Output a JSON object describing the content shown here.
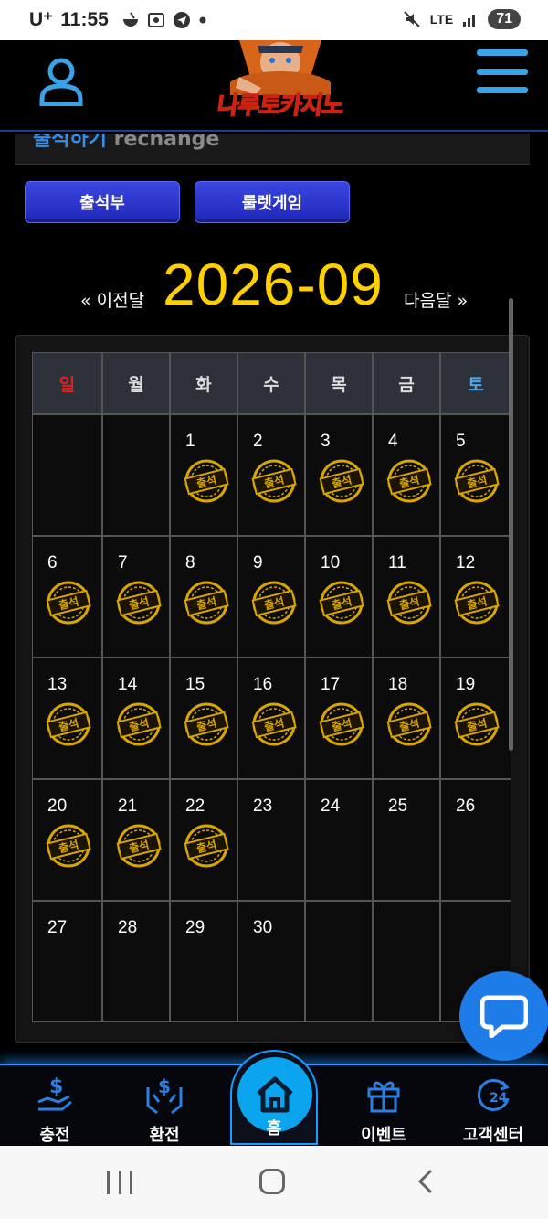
{
  "status_bar": {
    "carrier": "U⁺",
    "time": "11:55",
    "network": "LTE",
    "battery": "71"
  },
  "header": {
    "logo_text": "나루토카지노"
  },
  "subheader": {
    "title_ko": "출석하기",
    "title_en": "rechange"
  },
  "tabs": [
    {
      "label": "출석부"
    },
    {
      "label": "룰렛게임"
    }
  ],
  "month_nav": {
    "prev_label": "« 이전달",
    "current": "2026-09",
    "next_label": "다음달 »"
  },
  "calendar": {
    "weekdays": [
      "일",
      "월",
      "화",
      "수",
      "목",
      "금",
      "토"
    ],
    "stamp_label": "출석",
    "first_weekday": 2,
    "days_in_month": 30,
    "attended_through": 22
  },
  "bottom_nav": {
    "charge": "충전",
    "exchange": "환전",
    "home": "홈",
    "event": "이벤트",
    "support": "고객센터"
  },
  "colors": {
    "accent_blue": "#3aa3e8",
    "date_yellow": "#ffd000",
    "sunday_red": "#e02020",
    "saturday_blue": "#4aa8f0"
  }
}
